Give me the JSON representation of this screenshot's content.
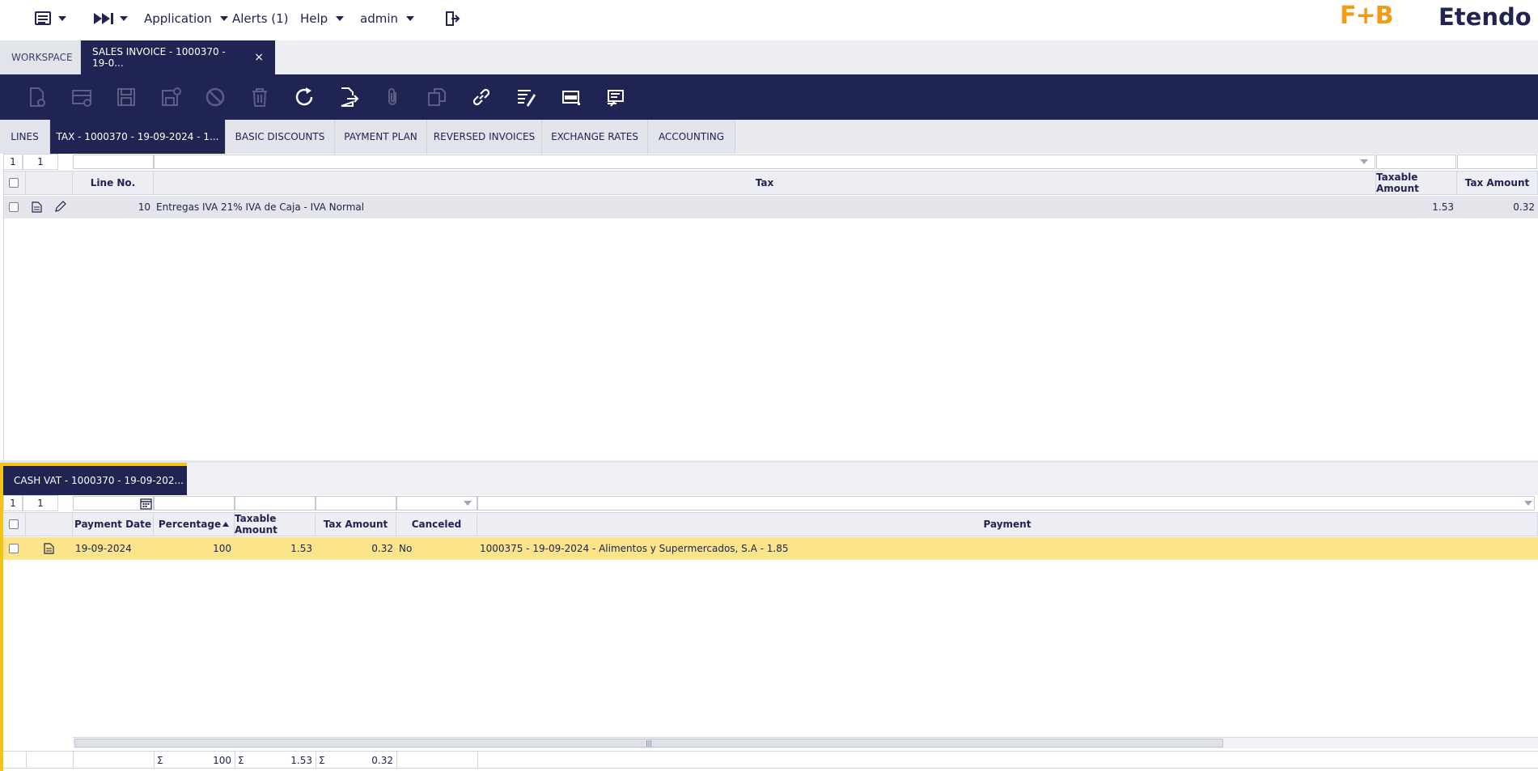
{
  "topbar": {
    "application_label": "Application",
    "alerts_label": "Alerts (1)",
    "help_label": "Help",
    "user_label": "admin",
    "brand_fb": "F+B",
    "brand_name": "Etendo"
  },
  "main_tabs": {
    "workspace": "WORKSPACE",
    "sales_invoice": "SALES INVOICE - 1000370 - 19-0...",
    "close_symbol": "×"
  },
  "toolbar": {
    "icons": [
      "new-document-icon",
      "new-row-icon",
      "save-icon",
      "save-close-icon",
      "cancel-icon",
      "delete-icon",
      "refresh-icon",
      "export-icon",
      "attach-icon",
      "clone-icon",
      "link-icon",
      "audit-icon",
      "grid-view-icon",
      "notes-icon"
    ]
  },
  "sub_tabs": {
    "lines": "LINES",
    "tax": "TAX - 1000370 - 19-09-2024 - 1...",
    "basic_discounts": "BASIC DISCOUNTS",
    "payment_plan": "PAYMENT PLAN",
    "reversed_invoices": "REVERSED INVOICES",
    "exchange_rates": "EXCHANGE RATES",
    "accounting": "ACCOUNTING"
  },
  "tax_grid": {
    "count_a": "1",
    "count_b": "1",
    "headers": {
      "line_no": "Line No.",
      "tax": "Tax",
      "taxable_amount": "Taxable Amount",
      "tax_amount": "Tax Amount"
    },
    "rows": [
      {
        "line_no": "10",
        "tax": "Entregas IVA 21% IVA de Caja - IVA Normal",
        "taxable_amount": "1.53",
        "tax_amount": "0.32"
      }
    ]
  },
  "cash_vat": {
    "tab_label": "CASH VAT - 1000370 - 19-09-202...",
    "count_a": "1",
    "count_b": "1",
    "headers": {
      "payment_date": "Payment Date",
      "percentage": "Percentage",
      "taxable_amount": "Taxable Amount",
      "tax_amount": "Tax Amount",
      "canceled": "Canceled",
      "payment": "Payment"
    },
    "rows": [
      {
        "payment_date": "19-09-2024",
        "percentage": "100",
        "taxable_amount": "1.53",
        "tax_amount": "0.32",
        "canceled": "No",
        "payment": "1000375 - 19-09-2024 - Alimentos y Supermercados, S.A - 1.85"
      }
    ],
    "summary": {
      "sigma": "Σ",
      "percentage": "100",
      "taxable_amount": "1.53",
      "tax_amount": "0.32"
    },
    "scroll_grip": "|||"
  },
  "colors": {
    "navy": "#202452",
    "accent_yellow": "#f0c419",
    "selected_row": "#fbe48a",
    "brand_orange": "#f29b17"
  }
}
